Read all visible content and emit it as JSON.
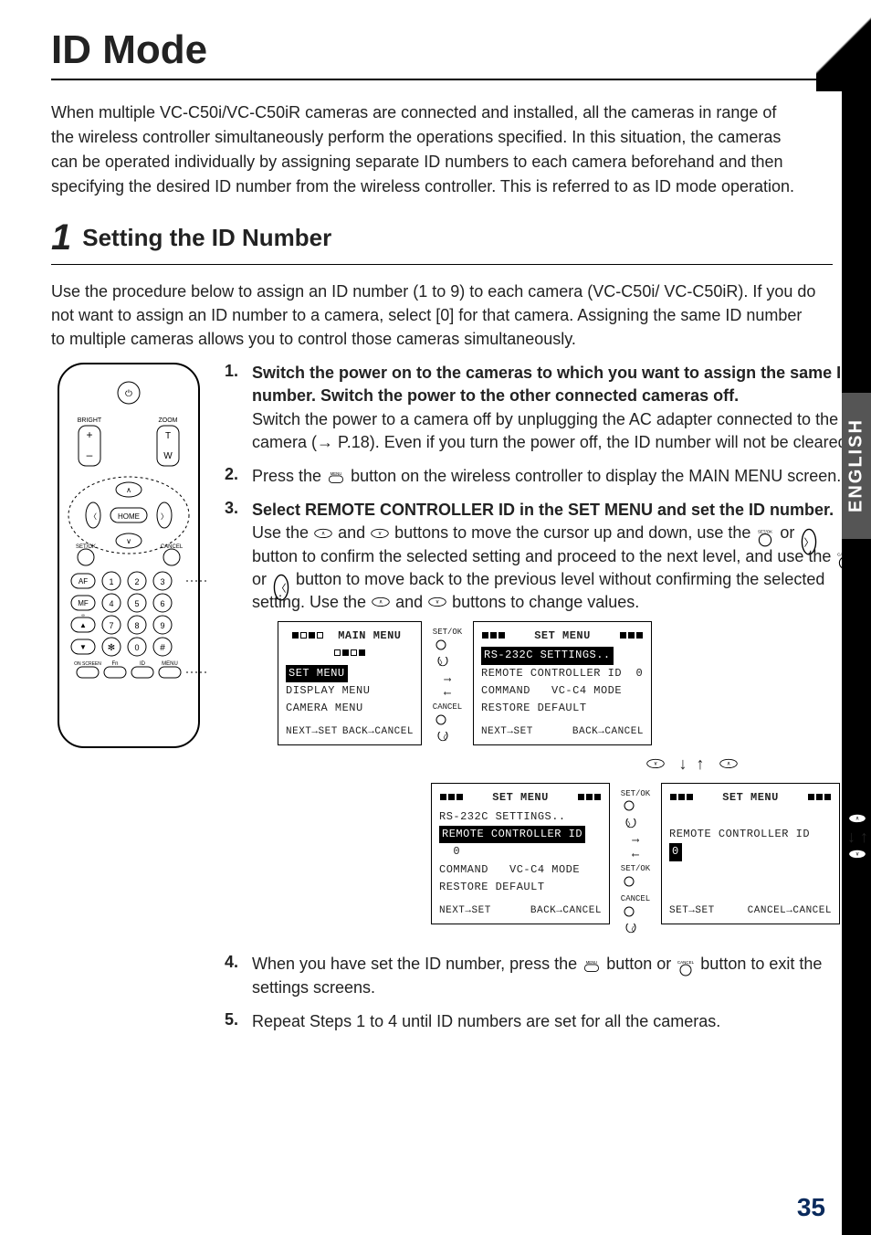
{
  "page": {
    "title": "ID Mode",
    "page_number": "35",
    "language_tab": "ENGLISH"
  },
  "intro": "When multiple VC-C50i/VC-C50iR cameras are connected and installed, all the cameras in range of the wireless controller simultaneously perform the operations specified. In this situation, the cameras can be operated individually by assigning separate ID numbers to each camera beforehand and then specifying the desired ID number from the wireless controller. This is referred to as ID mode operation.",
  "section": {
    "number": "1",
    "title": "Setting the ID Number",
    "intro": "Use the procedure below to assign an ID number (1 to 9) to each camera (VC-C50i/ VC-C50iR). If you do not want to assign an ID number to a camera, select [0] for that camera. Assigning the same ID number to multiple cameras allows you to control those cameras simultaneously."
  },
  "remote": {
    "labels": {
      "bright": "BRIGHT",
      "zoom": "ZOOM",
      "plus": "+",
      "minus": "–",
      "t": "T",
      "w": "W",
      "home": "HOME",
      "setok": "SET/OK",
      "cancel": "CANCEL",
      "af": "AF",
      "mf": "MF",
      "up_caret": "∞",
      "down_caret": "▼",
      "onscreen": "ON SCREEN",
      "fn": "Fn",
      "id": "ID",
      "menu": "MENU",
      "star": "✻",
      "hash": "#",
      "nums": [
        "1",
        "2",
        "3",
        "4",
        "5",
        "6",
        "7",
        "8",
        "9",
        "0"
      ]
    }
  },
  "steps": [
    {
      "n": "1.",
      "head": "Switch the power on to the cameras to which you want to assign the same ID number. Switch the power to the other connected cameras off.",
      "sub": "Switch the power to a camera off by unplugging the AC adapter connected to the camera (→ P.18). Even if you turn the power off, the ID number will not be cleared."
    },
    {
      "n": "2.",
      "head_a": "Press the ",
      "head_b": " button on the wireless controller to display the MAIN MENU screen.",
      "icon_label": "MENU"
    },
    {
      "n": "3.",
      "head": "Select REMOTE CONTROLLER ID in the SET MENU and set the ID number.",
      "sub_a": "Use the ",
      "sub_b": " and ",
      "sub_c": " buttons to move the cursor up and down, use the ",
      "sub_d": " or ",
      "sub_e": " button to confirm the selected setting and proceed to the next level, and use the ",
      "sub_f": " or ",
      "sub_g": " button to move back to the previous level without confirming the selected setting. Use the ",
      "sub_h": " and ",
      "sub_i": " buttons to change values.",
      "icon_setok": "SET/OK",
      "icon_cancel": "CANCEL"
    },
    {
      "n": "4.",
      "head_a": "When you have set the ID number, press the ",
      "head_b": " button or ",
      "head_c": " button to exit the settings screens.",
      "icon_menu": "MENU",
      "icon_cancel": "CANCEL"
    },
    {
      "n": "5.",
      "head": "Repeat Steps 1 to 4 until ID numbers are set for all the cameras."
    }
  ],
  "osd": {
    "main": {
      "title": "MAIN  MENU",
      "items": [
        "SET MENU",
        "DISPLAY MENU",
        "CAMERA MENU"
      ],
      "selected": 0,
      "foot_left": "NEXT→SET",
      "foot_right": "BACK→CANCEL"
    },
    "set1": {
      "title": "SET MENU",
      "items": [
        {
          "l": "RS-232C SETTINGS..",
          "sel": true
        },
        {
          "l": "REMOTE CONTROLLER ID",
          "v": "0"
        },
        {
          "l": "COMMAND",
          "v": "VC-C4 MODE"
        },
        {
          "l": "RESTORE DEFAULT"
        }
      ],
      "foot_left": "NEXT→SET",
      "foot_right": "BACK→CANCEL"
    },
    "set2": {
      "title": "SET MENU",
      "items": [
        {
          "l": "RS-232C SETTINGS.."
        },
        {
          "l": "REMOTE CONTROLLER ID",
          "v": "0",
          "sel": true
        },
        {
          "l": "COMMAND",
          "v": "VC-C4 MODE"
        },
        {
          "l": "RESTORE DEFAULT"
        }
      ],
      "foot_left": "NEXT→SET",
      "foot_right": "BACK→CANCEL"
    },
    "set3": {
      "title": "SET MENU",
      "line": "REMOTE CONTROLLER ID",
      "value": "0",
      "foot_left": "SET→SET",
      "foot_right": "CANCEL→CANCEL"
    },
    "mid_labels": {
      "setok": "SET/OK",
      "cancel": "CANCEL"
    }
  }
}
